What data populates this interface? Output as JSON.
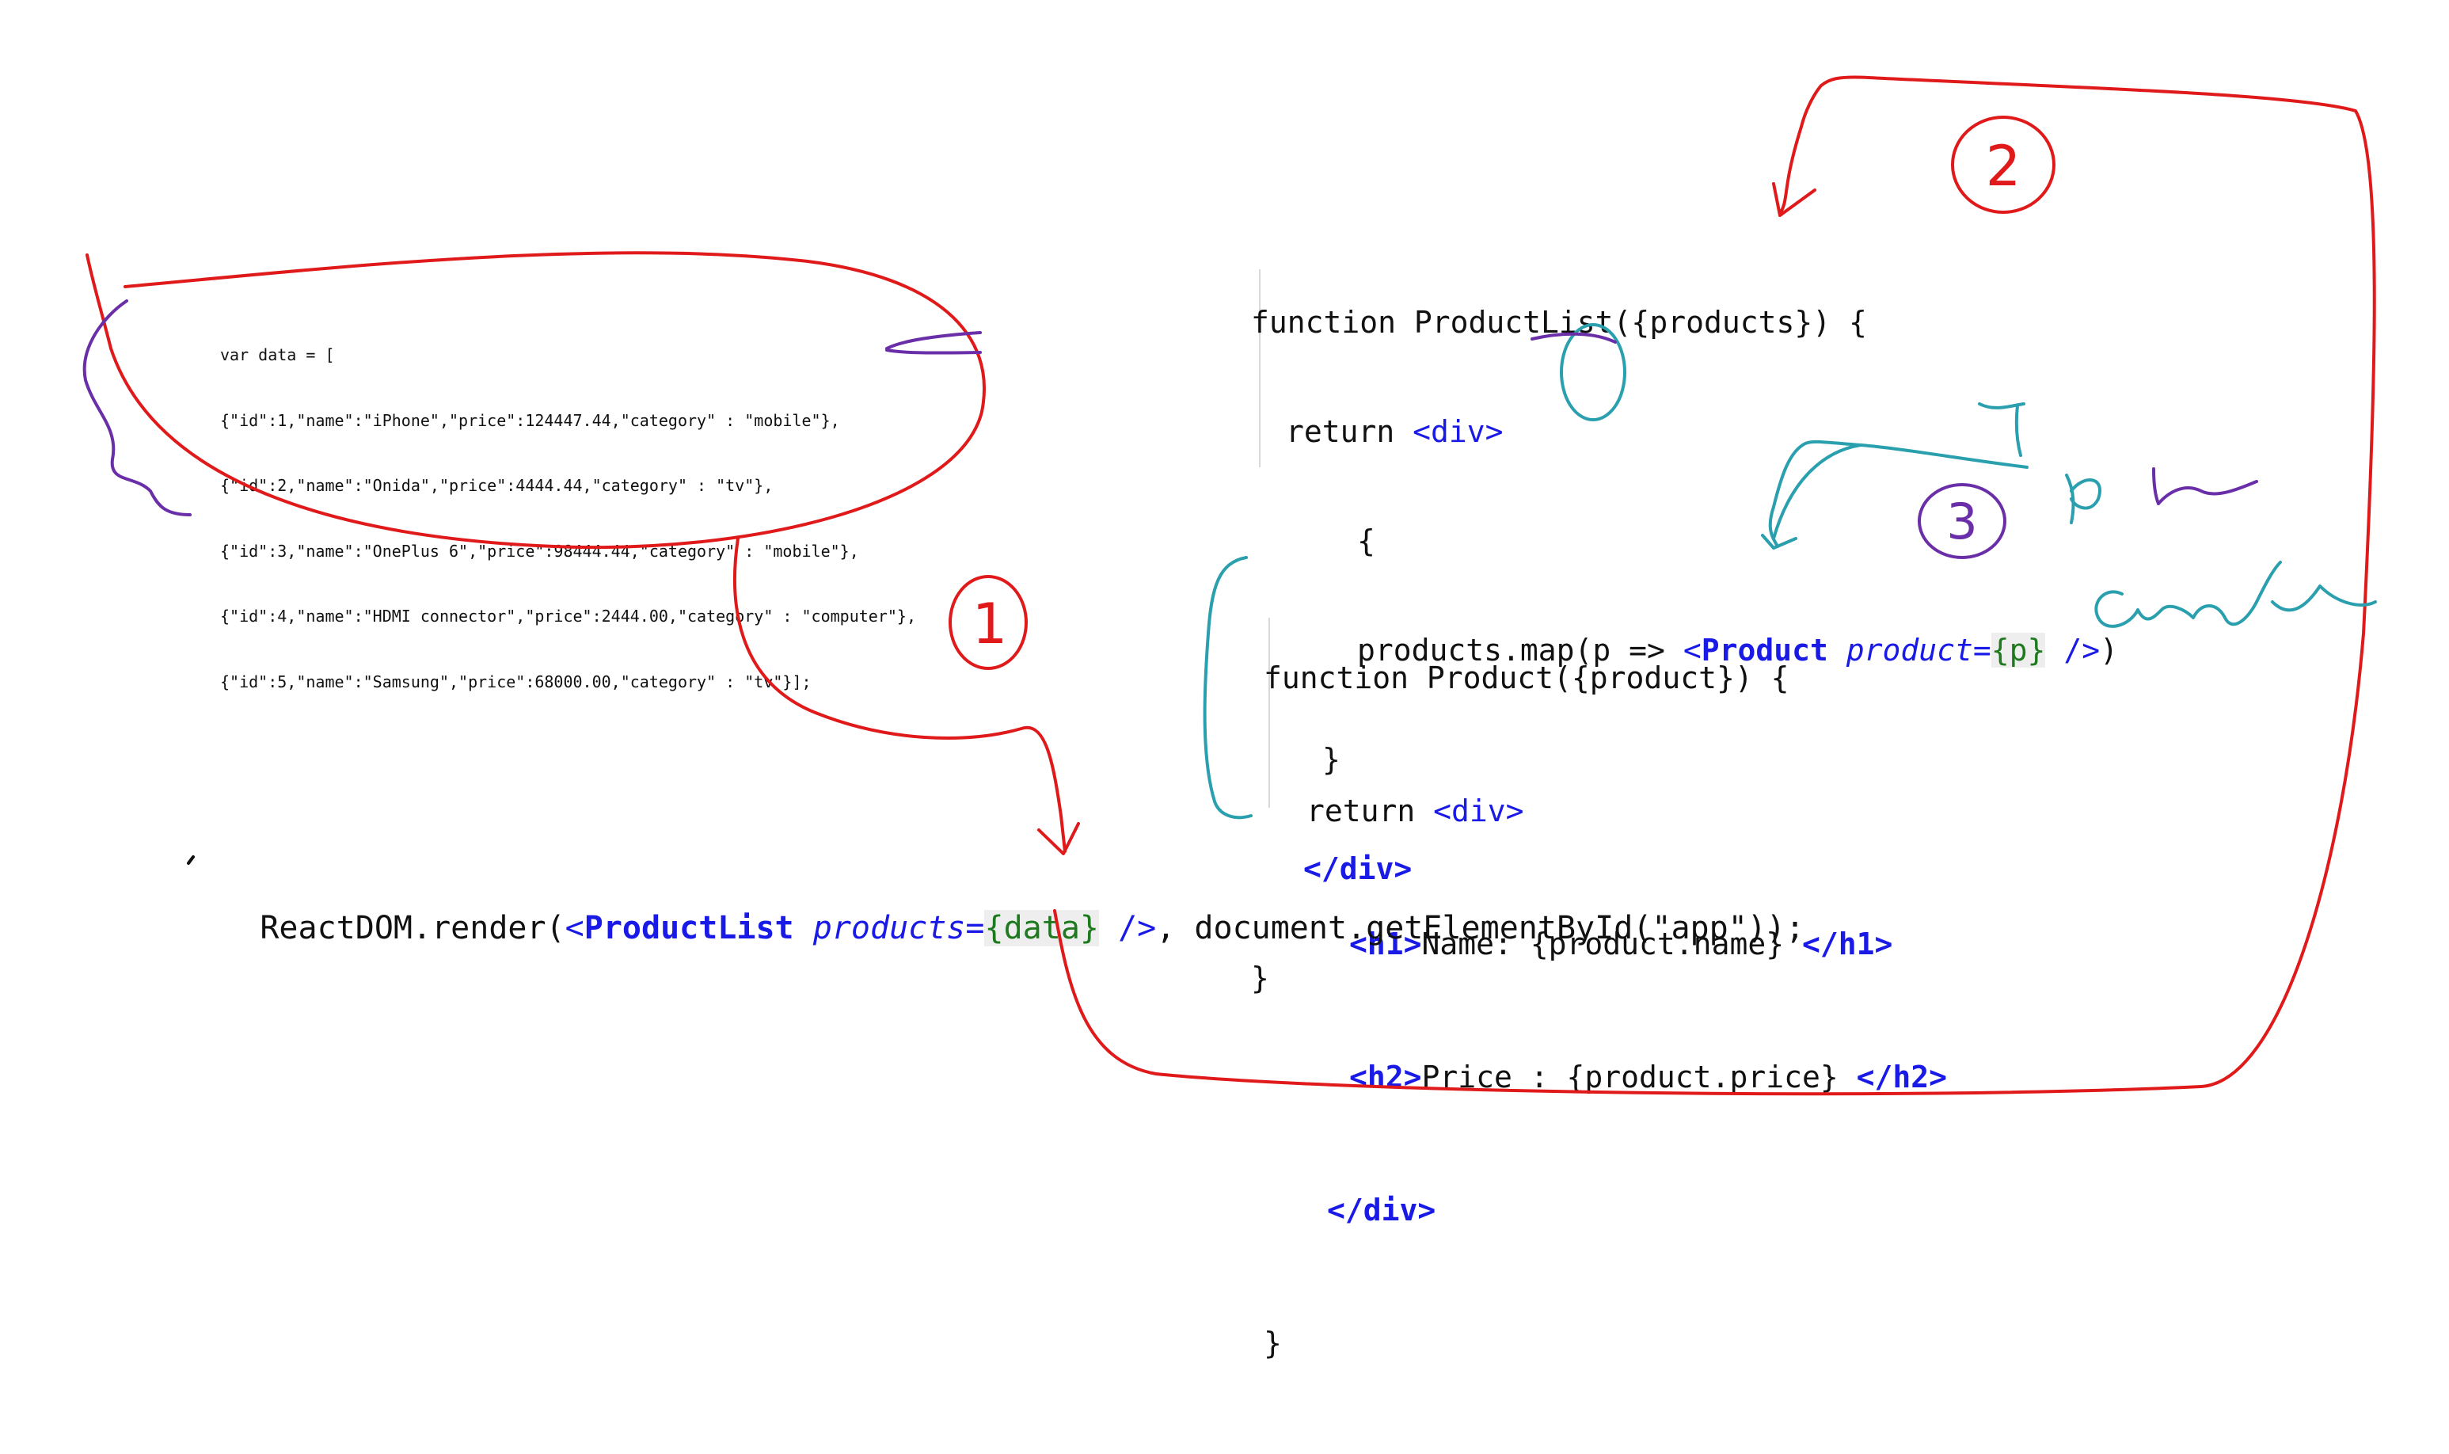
{
  "data_block": {
    "lines": [
      "var data = [",
      "{\"id\":1,\"name\":\"iPhone\",\"price\":124447.44,\"category\" : \"mobile\"},",
      "{\"id\":2,\"name\":\"Onida\",\"price\":4444.44,\"category\" : \"tv\"},",
      "{\"id\":3,\"name\":\"OnePlus 6\",\"price\":98444.44,\"category\" : \"mobile\"},",
      "{\"id\":4,\"name\":\"HDMI connector\",\"price\":2444.00,\"category\" : \"computer\"},",
      "{\"id\":5,\"name\":\"Samsung\",\"price\":68000.00,\"category\" : \"tv\"}];"
    ]
  },
  "product_list": {
    "line1": "function ProductList({products}) {",
    "ret": "return ",
    "div_open": "<div>",
    "brace_open": "{",
    "map_call": "products.map(p => ",
    "product_open": "<",
    "product_name": "Product",
    "product_attr": "product",
    "eq": "=",
    "product_expr": "{p}",
    "self_close": " />",
    "paren_close": ")",
    "brace_close": "}",
    "div_close": "</div>",
    "fn_close": "}"
  },
  "product": {
    "line1": "function Product({product}) {",
    "ret": "return ",
    "div_open": "<div>",
    "h1_open": "<h1>",
    "h1_text": "Name: {product.name} ",
    "h1_close": "</h1>",
    "h2_open": "<h2>",
    "h2_text": "Price : {product.price} ",
    "h2_close": "</h2>",
    "div_close": "</div>",
    "fn_close": "}"
  },
  "render_line": {
    "prefix": "ReactDOM.render(",
    "open_bracket": "<",
    "component": "ProductList",
    "attr": "products",
    "eq": "=",
    "expr": "{data}",
    "self_close": " />",
    "suffix": ", document.getElementById(\"app\"));"
  },
  "annotations": {
    "step1": "1",
    "step2": "2",
    "step3": "3",
    "colors": {
      "red_ink": "#e01a1a",
      "teal_ink": "#2a9fae",
      "purple_ink": "#6a2fa8"
    }
  }
}
